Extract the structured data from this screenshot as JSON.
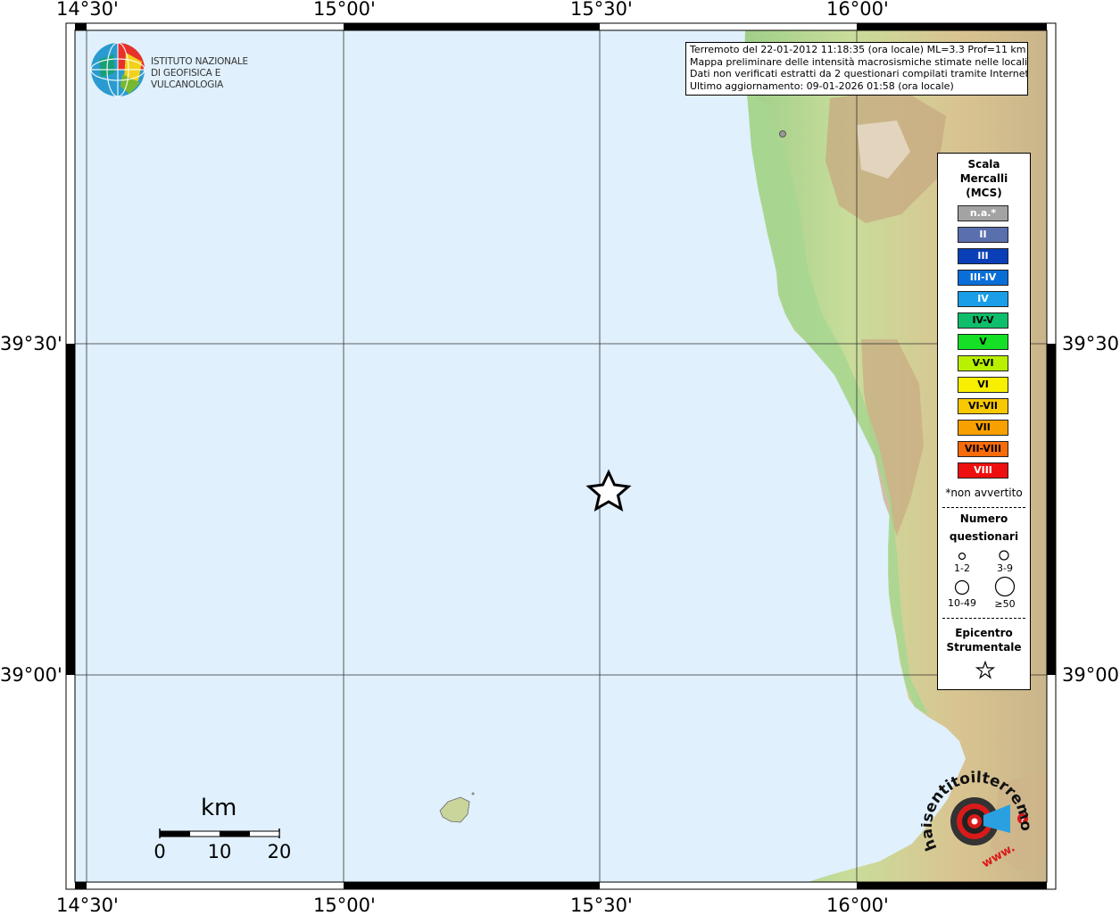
{
  "map": {
    "lon_ticks": [
      "14°30'",
      "15°00'",
      "15°30'",
      "16°00'"
    ],
    "lat_ticks": [
      "39°30'",
      "39°00'"
    ]
  },
  "info": {
    "line1": "Terremoto del 22-01-2012 11:18:35 (ora locale) ML=3.3 Prof=11 km",
    "line2": "Mappa preliminare delle intensità macrosismiche stimate nelle località",
    "line3": "Dati non verificati estratti da 2 questionari compilati tramite Internet.",
    "line4": "Ultimo aggiornamento: 09-01-2026 01:58 (ora locale)"
  },
  "logo": {
    "line1": "ISTITUTO NAZIONALE",
    "line2": "DI GEOFISICA E VULCANOLOGIA"
  },
  "legend": {
    "title1": "Scala",
    "title2": "Mercalli",
    "title3": "(MCS)",
    "scale": [
      {
        "label": "n.a.*",
        "color": "#a3a3a3"
      },
      {
        "label": "II",
        "color": "#5a6fad"
      },
      {
        "label": "III",
        "color": "#0a3fb8"
      },
      {
        "label": "III-IV",
        "color": "#0a6ed8"
      },
      {
        "label": "IV",
        "color": "#1a9ee8"
      },
      {
        "label": "IV-V",
        "color": "#0fbe6a"
      },
      {
        "label": "V",
        "color": "#15e025"
      },
      {
        "label": "V-VI",
        "color": "#b8f000"
      },
      {
        "label": "VI",
        "color": "#f8f000"
      },
      {
        "label": "VI-VII",
        "color": "#f8c800"
      },
      {
        "label": "VII",
        "color": "#f8a000"
      },
      {
        "label": "VII-VIII",
        "color": "#f86b0a"
      },
      {
        "label": "VIII",
        "color": "#ee1010"
      }
    ],
    "non_avvertito": "*non avvertito",
    "numero1": "Numero",
    "numero2": "questionari",
    "sizes": [
      "1-2",
      "3-9",
      "10-49",
      "≥50"
    ],
    "epicentro1": "Epicentro",
    "epicentro2": "Strumentale"
  },
  "scalebar": {
    "unit": "km",
    "ticks": [
      "0",
      "10",
      "20"
    ]
  },
  "hai_sentito": {
    "text": "haisentitoilterremoto.it",
    "www": "www."
  },
  "colors": {
    "sea": "#e0f0fc",
    "grid": "#303030"
  }
}
